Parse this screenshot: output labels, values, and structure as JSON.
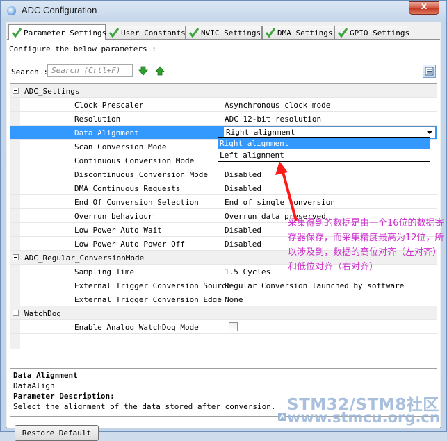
{
  "window": {
    "title": "ADC Configuration",
    "close_glyph": "x"
  },
  "tabs": [
    {
      "label": "Parameter Settings",
      "active": true
    },
    {
      "label": "User Constants",
      "active": false
    },
    {
      "label": "NVIC Settings",
      "active": false
    },
    {
      "label": "DMA Settings",
      "active": false
    },
    {
      "label": "GPIO Settings",
      "active": false
    }
  ],
  "panel": {
    "configure_label": "Configure the below parameters :",
    "search_label": "Search :",
    "search_placeholder": "Search (Crtl+F)"
  },
  "grid": {
    "categories": [
      {
        "name": "ADC_Settings",
        "expanded": true
      },
      {
        "name": "ADC_Regular_ConversionMode",
        "expanded": true
      },
      {
        "name": "WatchDog",
        "expanded": true
      }
    ],
    "rows": [
      {
        "name": "Clock Prescaler",
        "value": "Asynchronous clock mode"
      },
      {
        "name": "Resolution",
        "value": "ADC 12-bit resolution"
      },
      {
        "name": "Data Alignment",
        "value": "Right alignment"
      },
      {
        "name": "Scan Conversion Mode",
        "value": ""
      },
      {
        "name": "Continuous Conversion Mode",
        "value": ""
      },
      {
        "name": "Discontinuous Conversion Mode",
        "value": "Disabled"
      },
      {
        "name": "DMA Continuous Requests",
        "value": "Disabled"
      },
      {
        "name": "End Of Conversion Selection",
        "value": "End of single conversion"
      },
      {
        "name": "Overrun behaviour",
        "value": "Overrun data preserved"
      },
      {
        "name": "Low Power Auto Wait",
        "value": "Disabled"
      },
      {
        "name": "Low Power Auto Power Off",
        "value": "Disabled"
      },
      {
        "name": "Sampling Time",
        "value": "1.5 Cycles"
      },
      {
        "name": "External Trigger Conversion Source",
        "value": "Regular Conversion launched by software"
      },
      {
        "name": "External Trigger Conversion Edge",
        "value": "None"
      },
      {
        "name": "Enable Analog WatchDog Mode",
        "value": "",
        "checked": false
      }
    ],
    "dropdown_options": [
      "Right alignment",
      "Left alignment"
    ],
    "dropdown_highlighted": "Right alignment"
  },
  "description": {
    "title": "Data Alignment",
    "param_name": "DataAlign",
    "section_label": "Parameter Description:",
    "text": "Select the alignment of the data stored after conversion."
  },
  "buttons": {
    "restore_default": "Restore Default"
  },
  "annotation": {
    "text": "采集得到的数据是由一个16位的数据寄存器保存，而采集精度最高为12位，所以涉及到，数据的高位对齐（左对齐）和低位对齐（右对齐）",
    "color": "#cc33cc",
    "arrow_color": "#ff1a1a"
  },
  "watermark": {
    "line1": "STM32/STM8社区",
    "line2": "www.stmcu.org.cn"
  },
  "colors": {
    "selection": "#3399ff",
    "check_green": "#3aa63a",
    "arrow_green": "#2fa02f"
  }
}
